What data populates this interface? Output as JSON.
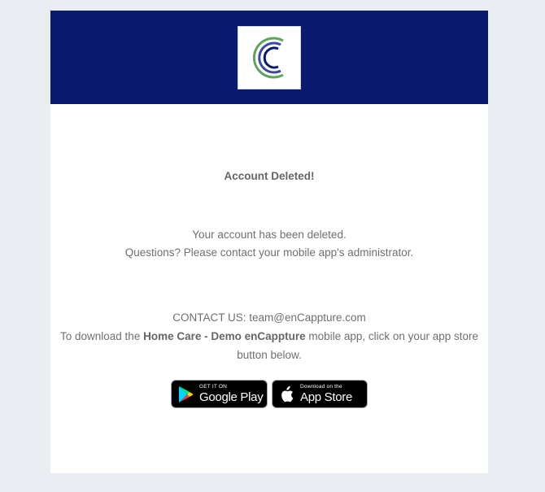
{
  "header": {
    "logo_icon": "encappture-logo-icon",
    "background": "#0a1a6e"
  },
  "main": {
    "title": "Account Deleted!",
    "message_line1": "Your account has been deleted.",
    "message_line2": "Questions? Please contact your mobile app's administrator.",
    "contact_line": "CONTACT US: team@enCappture.com",
    "download_prefix": "To download the ",
    "app_name": "Home Care - Demo enCappture",
    "download_suffix": " mobile app, click on your app store button below."
  },
  "stores": {
    "google_play": {
      "small": "GET IT ON",
      "big": "Google Play",
      "icon": "google-play-icon"
    },
    "app_store": {
      "small": "Download on the",
      "big": "App Store",
      "icon": "apple-icon"
    }
  },
  "colors": {
    "page_background": "#e9edf1",
    "header_blue": "#0a1a6e",
    "text_gray": "#6f6f6f"
  }
}
